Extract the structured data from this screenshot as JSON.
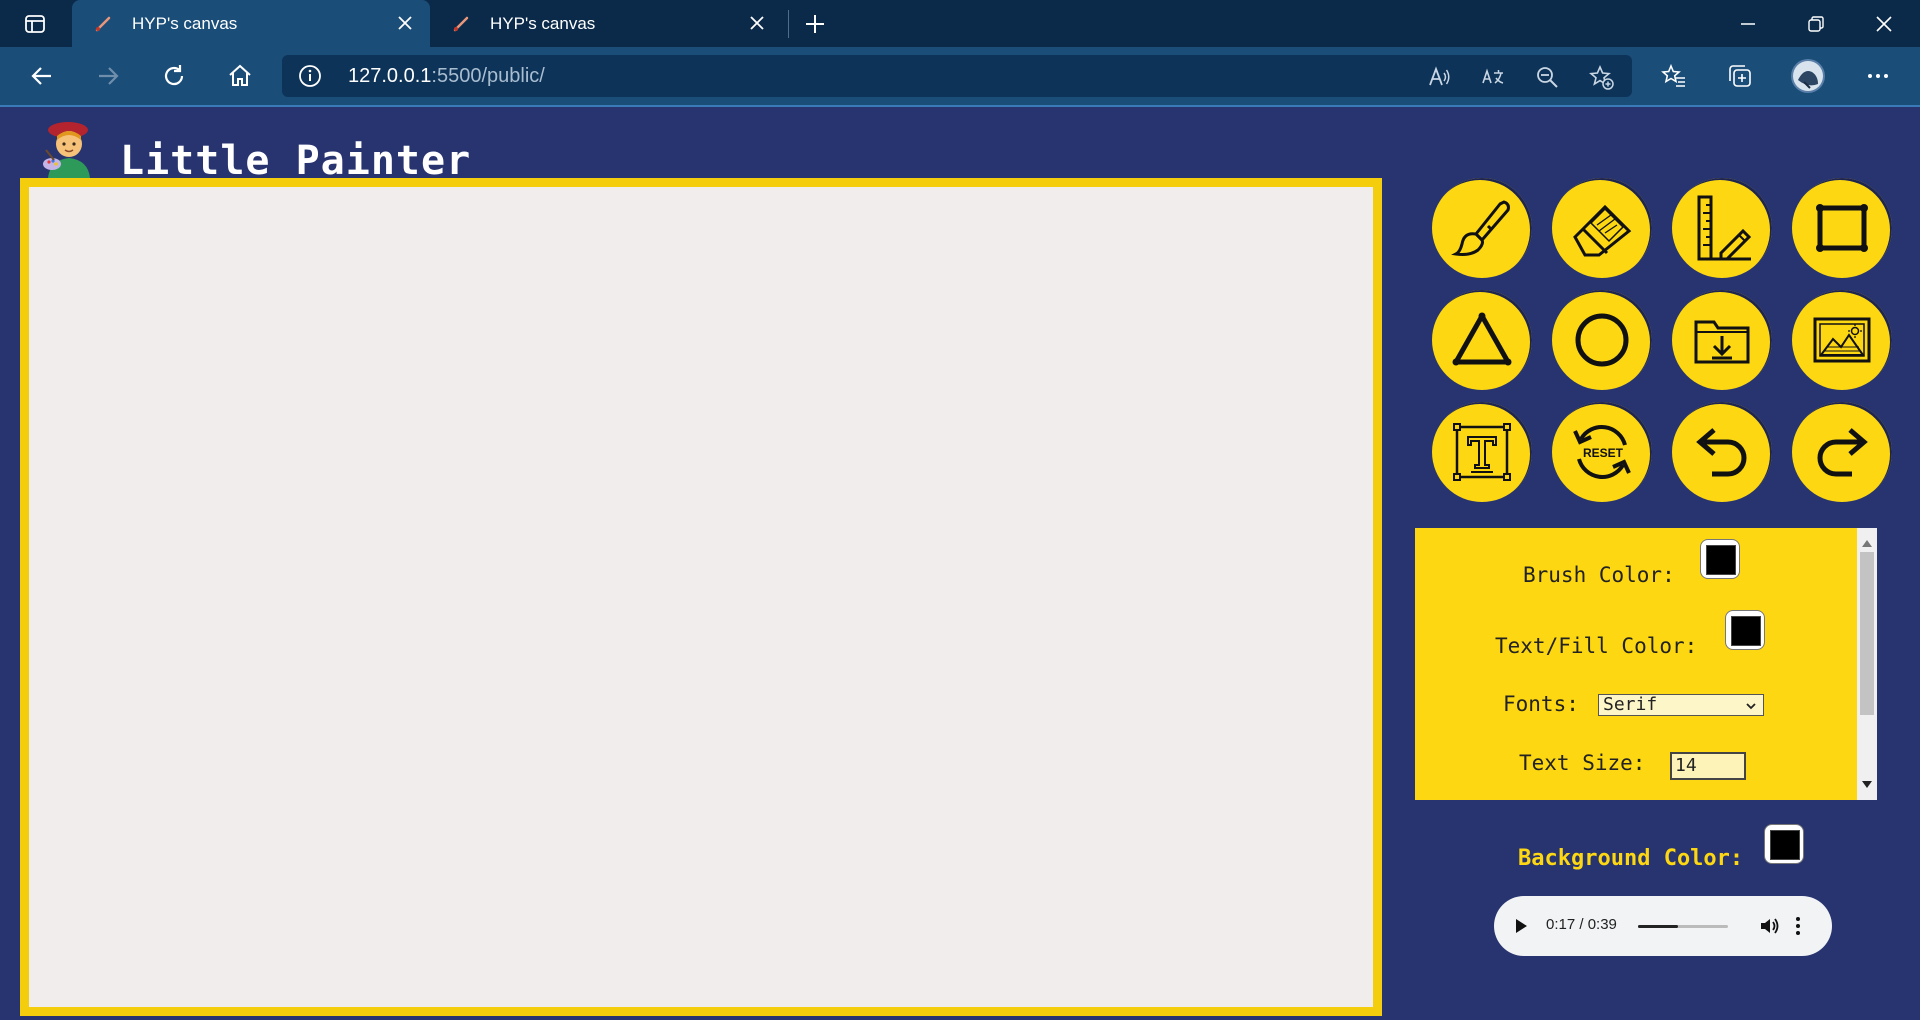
{
  "browser": {
    "tabs": [
      {
        "title": "HYP's canvas",
        "active": true
      },
      {
        "title": "HYP's canvas",
        "active": false
      }
    ],
    "url_host": "127.0.0.1",
    "url_rest": ":5500/public/"
  },
  "app": {
    "title": "Little Painter",
    "tools": [
      {
        "name": "brush"
      },
      {
        "name": "eraser"
      },
      {
        "name": "ruler-line"
      },
      {
        "name": "rectangle"
      },
      {
        "name": "triangle"
      },
      {
        "name": "circle"
      },
      {
        "name": "download-folder"
      },
      {
        "name": "image"
      },
      {
        "name": "text"
      },
      {
        "name": "reset"
      },
      {
        "name": "undo"
      },
      {
        "name": "redo"
      }
    ],
    "reset_label": "RESET",
    "settings": {
      "brush_color_label": "Brush Color:",
      "brush_color": "#000000",
      "fill_color_label": "Text/Fill Color:",
      "fill_color": "#000000",
      "fonts_label": "Fonts:",
      "font_selected": "Serif",
      "text_size_label": "Text Size:",
      "text_size": "14"
    },
    "background_color_label": "Background Color:",
    "background_color": "#000000",
    "audio": {
      "time": "0:17 / 0:39",
      "progress": 0.44
    },
    "colors": {
      "accent": "#fcd712",
      "page_bg": "#283470",
      "canvas": "#f0edec"
    }
  }
}
